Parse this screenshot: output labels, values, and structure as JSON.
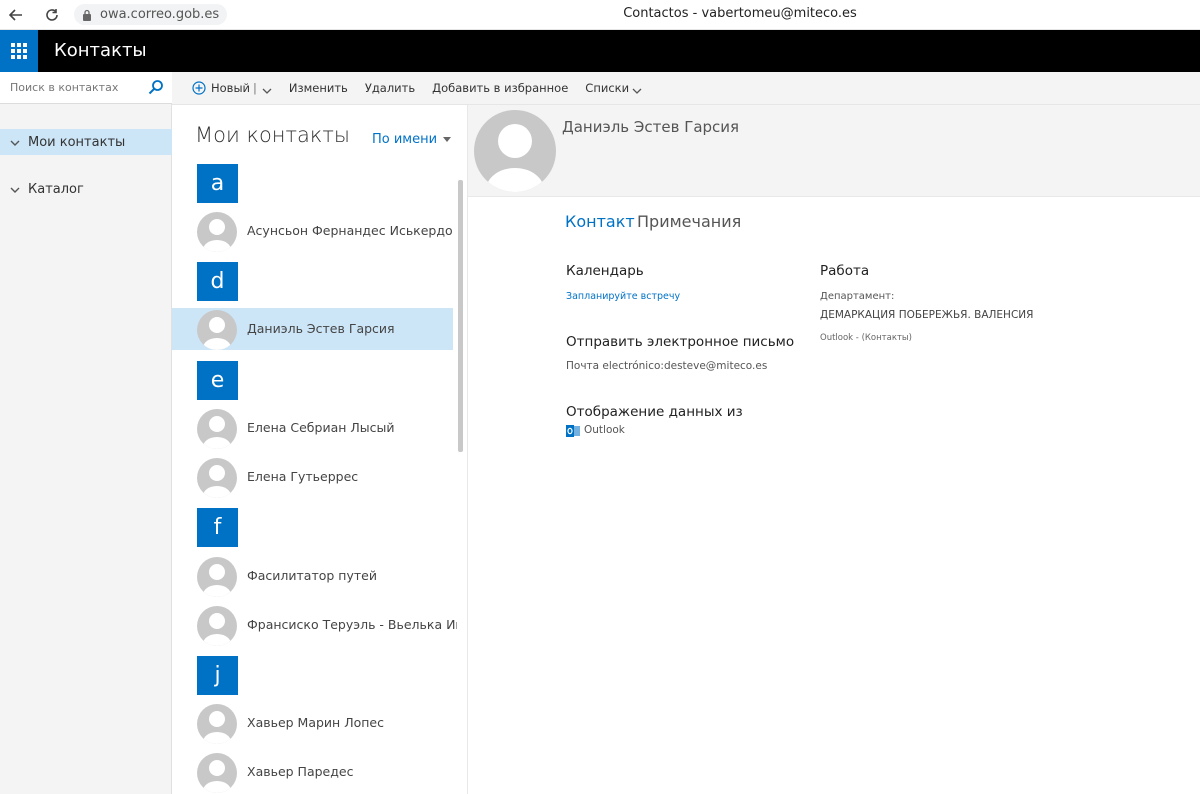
{
  "browser": {
    "url": "owa.correo.gob.es",
    "window_title": "Contactos - vabertomeu@miteco.es"
  },
  "app": {
    "title": "Контакты"
  },
  "sidebar": {
    "search_placeholder": "Поиск в контактах",
    "items": [
      {
        "label": "Мои контакты",
        "active": true
      },
      {
        "label": "Каталог",
        "active": false
      }
    ]
  },
  "toolbar": {
    "new_label": "Новый",
    "separator": "|",
    "edit_label": "Изменить",
    "delete_label": "Удалить",
    "favorites_label": "Добавить в избранное",
    "lists_label": "Списки"
  },
  "contact_list": {
    "title": "Мои контакты",
    "sort_label": "По имени",
    "letters": [
      "a",
      "d",
      "e",
      "f",
      "j"
    ],
    "contacts": [
      "Асунсьон Фернандес Иськердо",
      "Даниэль Эстев Гарсия",
      "Елена Себриан Лысый",
      "Елена Гутьеррес",
      "Фасилитатор путей",
      "Франсиско Теруэль - Вьелька Инже",
      "Хавьер Марин Лопес",
      "Хавьер Паредес"
    ]
  },
  "details": {
    "name": "Даниэль Эстев Гарсия",
    "tabs": [
      "Контакт",
      "Примечания"
    ],
    "calendar_heading": "Календарь",
    "calendar_link": "Запланируйте встречу",
    "email_heading": "Отправить электронное письмо",
    "email_value": "Почта electrónico:desteve@miteco.es",
    "source_heading": "Отображение данных из",
    "source_value": "Outlook",
    "work_heading": "Работа",
    "department_label": "Департамент:",
    "department_value": "ДЕМАРКАЦИЯ ПОБЕРЕЖЬЯ. ВАЛЕНСИЯ",
    "source_note": "Outlook - (Контакты)"
  },
  "colors": {
    "accent": "#0072c6",
    "selected": "#cde6f7",
    "app_bar": "#000000"
  }
}
